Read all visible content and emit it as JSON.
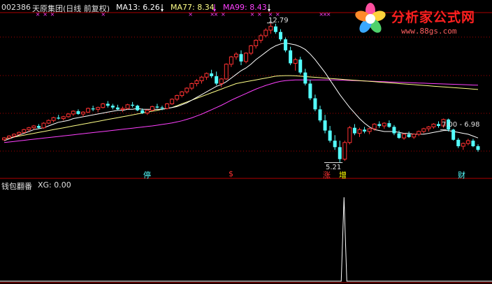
{
  "header": {
    "code": "002386",
    "name": "天原集团(日线 前复权)",
    "ma13_label": "MA13: 6.26",
    "ma77_label": "MA77: 8.34",
    "ma99_label": "MA99: 8.43"
  },
  "colors": {
    "up": "#ff3232",
    "down": "#54ffff",
    "ma13": "#ffffff",
    "ma77": "#ffff88",
    "ma99": "#ff40ff",
    "grid": "#aa0000",
    "axis": "#b00000"
  },
  "annotations": {
    "high": "12.79",
    "low": "5.21",
    "range": "7.00 - 6.98"
  },
  "signal_labels": [
    "停",
    "$",
    "涨",
    "增",
    "财"
  ],
  "sub": {
    "title": "钱包翻番",
    "xg_label": "XG: 0.00"
  },
  "logo": {
    "brand": "分析家公式网",
    "url": "www.88gs.com"
  },
  "chart_data": [
    {
      "type": "candlestick",
      "title": "002386 天原集团(日线 前复权)",
      "ylim": [
        5.0,
        13.2
      ],
      "candles": [
        [
          6.45,
          6.6,
          6.4,
          6.55
        ],
        [
          6.55,
          6.7,
          6.5,
          6.65
        ],
        [
          6.65,
          6.8,
          6.55,
          6.75
        ],
        [
          6.75,
          6.9,
          6.7,
          6.85
        ],
        [
          6.85,
          7.05,
          6.8,
          7.0
        ],
        [
          7.0,
          7.15,
          6.9,
          7.1
        ],
        [
          7.1,
          7.25,
          7.0,
          7.2
        ],
        [
          7.2,
          7.3,
          7.05,
          7.1
        ],
        [
          7.1,
          7.4,
          7.05,
          7.35
        ],
        [
          7.35,
          7.55,
          7.3,
          7.5
        ],
        [
          7.5,
          7.7,
          7.4,
          7.65
        ],
        [
          7.65,
          7.8,
          7.55,
          7.6
        ],
        [
          7.6,
          7.75,
          7.5,
          7.7
        ],
        [
          7.7,
          7.9,
          7.65,
          7.85
        ],
        [
          7.85,
          8.05,
          7.75,
          8.0
        ],
        [
          8.0,
          8.1,
          7.8,
          7.85
        ],
        [
          7.85,
          8.0,
          7.7,
          7.95
        ],
        [
          7.95,
          8.2,
          7.9,
          8.15
        ],
        [
          8.15,
          8.3,
          8.0,
          8.1
        ],
        [
          8.1,
          8.25,
          7.95,
          8.2
        ],
        [
          8.2,
          8.45,
          8.15,
          8.4
        ],
        [
          8.4,
          8.55,
          8.2,
          8.3
        ],
        [
          8.3,
          8.4,
          8.1,
          8.2
        ],
        [
          8.2,
          8.35,
          8.05,
          8.1
        ],
        [
          8.1,
          8.25,
          7.95,
          8.15
        ],
        [
          8.15,
          8.4,
          8.1,
          8.35
        ],
        [
          8.35,
          8.5,
          8.2,
          8.3
        ],
        [
          8.3,
          8.35,
          8.0,
          8.05
        ],
        [
          8.05,
          8.15,
          7.85,
          7.9
        ],
        [
          7.9,
          8.1,
          7.8,
          8.05
        ],
        [
          8.05,
          8.3,
          8.0,
          8.25
        ],
        [
          8.25,
          8.4,
          8.15,
          8.2
        ],
        [
          8.2,
          8.3,
          8.05,
          8.15
        ],
        [
          8.15,
          8.45,
          8.1,
          8.4
        ],
        [
          8.4,
          8.7,
          8.35,
          8.65
        ],
        [
          8.65,
          8.9,
          8.55,
          8.85
        ],
        [
          8.85,
          9.1,
          8.75,
          9.05
        ],
        [
          9.05,
          9.3,
          8.95,
          9.25
        ],
        [
          9.25,
          9.55,
          9.15,
          9.5
        ],
        [
          9.5,
          9.75,
          9.35,
          9.65
        ],
        [
          9.65,
          9.9,
          9.5,
          9.85
        ],
        [
          9.85,
          10.1,
          9.7,
          10.05
        ],
        [
          10.05,
          10.25,
          9.8,
          9.9
        ],
        [
          9.9,
          10.15,
          9.4,
          9.5
        ],
        [
          9.5,
          9.8,
          9.3,
          9.75
        ],
        [
          9.75,
          10.6,
          9.7,
          10.55
        ],
        [
          10.55,
          11.0,
          10.4,
          10.95
        ],
        [
          10.95,
          11.2,
          10.8,
          11.1
        ],
        [
          11.1,
          11.3,
          10.5,
          10.7
        ],
        [
          10.7,
          11.2,
          10.6,
          11.15
        ],
        [
          11.15,
          11.6,
          11.05,
          11.55
        ],
        [
          11.55,
          11.9,
          11.4,
          11.85
        ],
        [
          11.85,
          12.2,
          11.7,
          12.1
        ],
        [
          12.1,
          12.5,
          12.0,
          12.4
        ],
        [
          12.4,
          12.79,
          12.2,
          12.6
        ],
        [
          12.6,
          12.75,
          12.2,
          12.3
        ],
        [
          12.3,
          12.45,
          11.8,
          11.9
        ],
        [
          11.9,
          12.0,
          11.2,
          11.3
        ],
        [
          11.3,
          11.5,
          10.5,
          10.6
        ],
        [
          10.6,
          10.9,
          10.2,
          10.8
        ],
        [
          10.8,
          10.95,
          10.0,
          10.1
        ],
        [
          10.1,
          10.3,
          9.4,
          9.5
        ],
        [
          9.5,
          9.7,
          8.6,
          8.7
        ],
        [
          8.7,
          8.9,
          8.0,
          8.1
        ],
        [
          8.1,
          8.3,
          7.4,
          7.5
        ],
        [
          7.5,
          7.8,
          6.8,
          6.95
        ],
        [
          6.95,
          7.2,
          6.3,
          6.4
        ],
        [
          6.4,
          6.7,
          5.9,
          6.05
        ],
        [
          6.05,
          6.4,
          5.21,
          5.4
        ],
        [
          5.4,
          6.4,
          5.3,
          6.3
        ],
        [
          6.3,
          7.2,
          6.2,
          7.1
        ],
        [
          7.1,
          7.3,
          6.7,
          6.8
        ],
        [
          6.8,
          7.1,
          6.6,
          7.0
        ],
        [
          7.0,
          7.15,
          6.8,
          6.9
        ],
        [
          6.9,
          7.1,
          6.75,
          7.05
        ],
        [
          7.05,
          7.35,
          6.95,
          7.3
        ],
        [
          7.3,
          7.45,
          7.1,
          7.2
        ],
        [
          7.2,
          7.4,
          7.05,
          7.35
        ],
        [
          7.35,
          7.5,
          7.1,
          7.15
        ],
        [
          7.15,
          7.25,
          6.7,
          6.8
        ],
        [
          6.8,
          6.95,
          6.5,
          6.55
        ],
        [
          6.55,
          6.8,
          6.45,
          6.75
        ],
        [
          6.75,
          6.9,
          6.55,
          6.6
        ],
        [
          6.6,
          6.8,
          6.5,
          6.75
        ],
        [
          6.75,
          6.95,
          6.65,
          6.9
        ],
        [
          6.9,
          7.1,
          6.8,
          7.05
        ],
        [
          7.05,
          7.2,
          6.9,
          7.15
        ],
        [
          7.15,
          7.35,
          7.05,
          7.3
        ],
        [
          7.3,
          7.45,
          7.1,
          7.2
        ],
        [
          7.2,
          7.6,
          7.1,
          7.55
        ],
        [
          7.55,
          7.6,
          6.9,
          7.0
        ],
        [
          7.0,
          7.05,
          6.4,
          6.45
        ],
        [
          6.45,
          6.55,
          6.0,
          6.1
        ],
        [
          6.1,
          6.3,
          5.9,
          6.25
        ],
        [
          6.25,
          6.5,
          6.15,
          6.4
        ],
        [
          6.4,
          6.5,
          6.05,
          6.1
        ],
        [
          6.1,
          6.2,
          5.8,
          5.9
        ]
      ],
      "ma13": [
        6.4,
        6.5,
        6.6,
        6.7,
        6.8,
        6.9,
        7.0,
        7.05,
        7.1,
        7.2,
        7.3,
        7.4,
        7.45,
        7.5,
        7.6,
        7.65,
        7.7,
        7.75,
        7.8,
        7.85,
        7.9,
        7.95,
        8.0,
        8.05,
        8.05,
        8.1,
        8.1,
        8.15,
        8.1,
        8.1,
        8.1,
        8.1,
        8.1,
        8.15,
        8.2,
        8.25,
        8.35,
        8.45,
        8.6,
        8.75,
        8.9,
        9.05,
        9.2,
        9.35,
        9.45,
        9.6,
        9.8,
        10.0,
        10.2,
        10.35,
        10.55,
        10.8,
        11.0,
        11.2,
        11.4,
        11.55,
        11.65,
        11.7,
        11.65,
        11.6,
        11.5,
        11.35,
        11.1,
        10.8,
        10.45,
        10.1,
        9.7,
        9.3,
        8.9,
        8.55,
        8.2,
        7.9,
        7.6,
        7.35,
        7.15,
        7.0,
        6.95,
        6.9,
        6.9,
        6.9,
        6.85,
        6.8,
        6.8,
        6.75,
        6.75,
        6.75,
        6.8,
        6.85,
        6.9,
        6.95,
        6.95,
        6.9,
        6.85,
        6.8,
        6.75,
        6.65,
        6.55
      ],
      "ma77": [
        6.5,
        6.55,
        6.6,
        6.65,
        6.7,
        6.75,
        6.8,
        6.85,
        6.9,
        6.95,
        7.0,
        7.05,
        7.1,
        7.15,
        7.2,
        7.25,
        7.3,
        7.35,
        7.4,
        7.45,
        7.5,
        7.55,
        7.6,
        7.65,
        7.7,
        7.75,
        7.8,
        7.85,
        7.9,
        7.95,
        8.0,
        8.05,
        8.1,
        8.15,
        8.2,
        8.3,
        8.4,
        8.5,
        8.6,
        8.7,
        8.8,
        8.9,
        9.0,
        9.1,
        9.2,
        9.3,
        9.4,
        9.5,
        9.55,
        9.6,
        9.65,
        9.7,
        9.75,
        9.8,
        9.85,
        9.9,
        9.92,
        9.93,
        9.93,
        9.92,
        9.9,
        9.88,
        9.86,
        9.84,
        9.82,
        9.8,
        9.78,
        9.76,
        9.74,
        9.72,
        9.7,
        9.68,
        9.66,
        9.64,
        9.62,
        9.6,
        9.58,
        9.56,
        9.54,
        9.52,
        9.5,
        9.48,
        9.46,
        9.44,
        9.42,
        9.4,
        9.38,
        9.36,
        9.34,
        9.32,
        9.3,
        9.28,
        9.26,
        9.24,
        9.22,
        9.2,
        9.18
      ],
      "ma99": [
        6.3,
        6.33,
        6.36,
        6.39,
        6.42,
        6.45,
        6.48,
        6.51,
        6.54,
        6.57,
        6.6,
        6.63,
        6.66,
        6.69,
        6.72,
        6.75,
        6.78,
        6.81,
        6.84,
        6.87,
        6.9,
        6.93,
        6.96,
        6.99,
        7.02,
        7.05,
        7.08,
        7.11,
        7.14,
        7.17,
        7.2,
        7.24,
        7.28,
        7.32,
        7.36,
        7.42,
        7.48,
        7.56,
        7.64,
        7.74,
        7.84,
        7.96,
        8.08,
        8.2,
        8.32,
        8.46,
        8.6,
        8.72,
        8.84,
        8.96,
        9.08,
        9.2,
        9.3,
        9.4,
        9.48,
        9.56,
        9.62,
        9.66,
        9.68,
        9.7,
        9.7,
        9.7,
        9.7,
        9.7,
        9.7,
        9.7,
        9.7,
        9.7,
        9.69,
        9.68,
        9.67,
        9.66,
        9.65,
        9.64,
        9.63,
        9.62,
        9.61,
        9.6,
        9.59,
        9.58,
        9.57,
        9.56,
        9.55,
        9.54,
        9.53,
        9.52,
        9.51,
        9.5,
        9.49,
        9.48,
        9.47,
        9.46,
        9.45,
        9.44,
        9.43,
        9.42,
        9.41
      ],
      "series": [
        {
          "name": "MA13",
          "ref": "ma13"
        },
        {
          "name": "MA77",
          "ref": "ma77"
        },
        {
          "name": "MA99",
          "ref": "ma99"
        }
      ]
    },
    {
      "type": "line",
      "title": "钱包翻番",
      "series": [
        {
          "name": "XG",
          "values_note": "all 0 except one spike",
          "spike_index": 68,
          "spike_value": 1.0
        }
      ],
      "ylim": [
        0,
        1.05
      ]
    }
  ]
}
